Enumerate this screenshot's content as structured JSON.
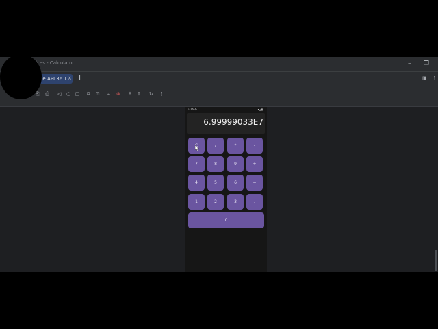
{
  "window": {
    "title": "vices - Calculator",
    "minimize": "–",
    "maximize": "❐"
  },
  "tabs": [
    {
      "label": "ne API 36.1",
      "close": "×"
    }
  ],
  "tab_add": "+",
  "toolbar_icons": [
    "screenshot-icon",
    "record-icon",
    "back-icon",
    "home-icon",
    "overview-icon",
    "snapshot-icon",
    "camera-icon",
    "layout-inspect-icon",
    "record-screen-icon",
    "upload-icon",
    "download-icon",
    "rotate-icon",
    "more-icon"
  ],
  "phone": {
    "status": {
      "time": "5:26 ⚙",
      "right": "▾◢▮"
    },
    "display": "6.99999033E7",
    "keys": [
      [
        "C",
        "/",
        "*",
        "-"
      ],
      [
        "7",
        "8",
        "9",
        "+"
      ],
      [
        "4",
        "5",
        "6",
        "="
      ],
      [
        "1",
        "2",
        "3",
        "."
      ]
    ],
    "zero": "0"
  },
  "colors": {
    "key": "#6a55a0",
    "tab_active": "#2e436e",
    "ide_bg": "#1e1f22"
  }
}
